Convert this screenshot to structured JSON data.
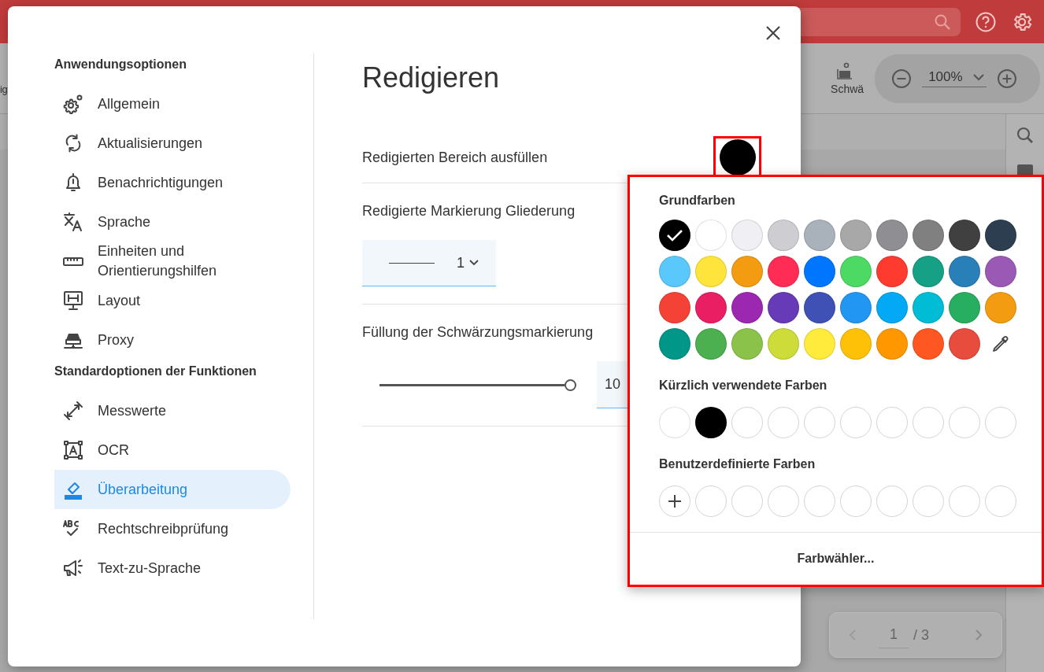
{
  "app": {
    "toolbar": {
      "left_fragment": "ig",
      "redact_label": "Schwä",
      "zoom": "100%"
    },
    "page_nav": {
      "current": "1",
      "total": "/ 3"
    }
  },
  "dialog": {
    "sidebar": [
      {
        "heading": "Anwendungsoptionen",
        "items": [
          {
            "label": "Allgemein",
            "selected": false
          },
          {
            "label": "Aktualisierungen",
            "selected": false
          },
          {
            "label": "Benachrichtigungen",
            "selected": false
          },
          {
            "label": "Sprache",
            "selected": false
          },
          {
            "label": "Einheiten und Orientierungshilfen",
            "selected": false
          },
          {
            "label": "Layout",
            "selected": false
          },
          {
            "label": "Proxy",
            "selected": false
          }
        ]
      },
      {
        "heading": "Standardoptionen der Funktionen",
        "items": [
          {
            "label": "Messwerte",
            "selected": false
          },
          {
            "label": "OCR",
            "selected": false
          },
          {
            "label": "Überarbeitung",
            "selected": true
          },
          {
            "label": "Rechtschreibprüfung",
            "selected": false
          },
          {
            "label": "Text-zu-Sprache",
            "selected": false
          }
        ]
      }
    ],
    "title": "Redigieren",
    "settings": [
      {
        "kind": "color",
        "label": "Redigierten Bereich ausfüllen",
        "color": "#000000"
      },
      {
        "kind": "outline",
        "label": "Redigierte Markierung Gliederung",
        "value": "1"
      },
      {
        "kind": "slider",
        "label": "Füllung der Schwärzungsmarkierung",
        "level": 1,
        "value": "10"
      }
    ]
  },
  "color_popup": {
    "basic_heading": "Grundfarben",
    "basic_colors": [
      {
        "kind": "color",
        "color": "#000000",
        "selected": true
      },
      {
        "kind": "color",
        "color": "#ffffff",
        "selected": false
      },
      {
        "kind": "color",
        "color": "#efeff4",
        "selected": false
      },
      {
        "kind": "color",
        "color": "#cecdd2",
        "selected": false
      },
      {
        "kind": "color",
        "color": "#a9b1ba",
        "selected": false
      },
      {
        "kind": "color",
        "color": "#a8a8a8",
        "selected": false
      },
      {
        "kind": "color",
        "color": "#8e8e93",
        "selected": false
      },
      {
        "kind": "color",
        "color": "#808080",
        "selected": false
      },
      {
        "kind": "color",
        "color": "#404040",
        "selected": false
      },
      {
        "kind": "color",
        "color": "#2c3e50",
        "selected": false
      },
      {
        "kind": "color",
        "color": "#5ac8fa",
        "selected": false
      },
      {
        "kind": "color",
        "color": "#ffe53b",
        "selected": false
      },
      {
        "kind": "color",
        "color": "#f39c12",
        "selected": false
      },
      {
        "kind": "color",
        "color": "#ff2d55",
        "selected": false
      },
      {
        "kind": "color",
        "color": "#0076ff",
        "selected": false
      },
      {
        "kind": "color",
        "color": "#4cd964",
        "selected": false
      },
      {
        "kind": "color",
        "color": "#ff3b30",
        "selected": false
      },
      {
        "kind": "color",
        "color": "#16a085",
        "selected": false
      },
      {
        "kind": "color",
        "color": "#2980b9",
        "selected": false
      },
      {
        "kind": "color",
        "color": "#9b59b6",
        "selected": false
      },
      {
        "kind": "color",
        "color": "#f44336",
        "selected": false
      },
      {
        "kind": "color",
        "color": "#e91e63",
        "selected": false
      },
      {
        "kind": "color",
        "color": "#9c27b0",
        "selected": false
      },
      {
        "kind": "color",
        "color": "#673ab7",
        "selected": false
      },
      {
        "kind": "color",
        "color": "#3f51b5",
        "selected": false
      },
      {
        "kind": "color",
        "color": "#2196f3",
        "selected": false
      },
      {
        "kind": "color",
        "color": "#03a9f4",
        "selected": false
      },
      {
        "kind": "color",
        "color": "#00bcd4",
        "selected": false
      },
      {
        "kind": "color",
        "color": "#27ae60",
        "selected": false
      },
      {
        "kind": "color",
        "color": "#f39c12",
        "selected": false
      },
      {
        "kind": "color",
        "color": "#009688",
        "selected": false
      },
      {
        "kind": "color",
        "color": "#4caf50",
        "selected": false
      },
      {
        "kind": "color",
        "color": "#8bc34a",
        "selected": false
      },
      {
        "kind": "color",
        "color": "#cddc39",
        "selected": false
      },
      {
        "kind": "color",
        "color": "#ffeb3b",
        "selected": false
      },
      {
        "kind": "color",
        "color": "#ffc107",
        "selected": false
      },
      {
        "kind": "color",
        "color": "#ff9800",
        "selected": false
      },
      {
        "kind": "color",
        "color": "#ff5722",
        "selected": false
      },
      {
        "kind": "color",
        "color": "#e74c3c",
        "selected": false
      },
      {
        "kind": "eyedropper"
      }
    ],
    "recent_heading": "Kürzlich verwendete Farben",
    "recent_colors": [
      {
        "kind": "color",
        "color": "#ffffff"
      },
      {
        "kind": "color",
        "color": "#000000"
      },
      {
        "kind": "empty"
      },
      {
        "kind": "empty"
      },
      {
        "kind": "empty"
      },
      {
        "kind": "empty"
      },
      {
        "kind": "empty"
      },
      {
        "kind": "empty"
      },
      {
        "kind": "empty"
      },
      {
        "kind": "empty"
      }
    ],
    "custom_heading": "Benutzerdefinierte Farben",
    "custom_colors": [
      {
        "kind": "add"
      },
      {
        "kind": "empty"
      },
      {
        "kind": "empty"
      },
      {
        "kind": "empty"
      },
      {
        "kind": "empty"
      },
      {
        "kind": "empty"
      },
      {
        "kind": "empty"
      },
      {
        "kind": "empty"
      },
      {
        "kind": "empty"
      },
      {
        "kind": "empty"
      }
    ],
    "picker_button": "Farbwähler..."
  }
}
